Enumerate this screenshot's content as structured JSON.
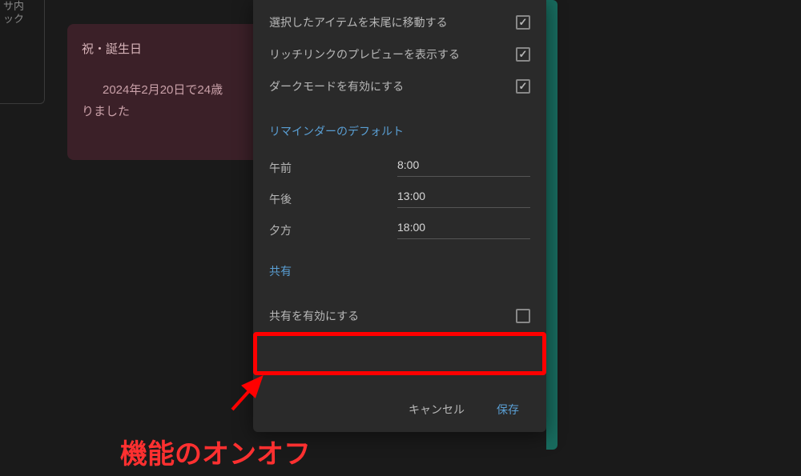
{
  "sidebar": {
    "fragment_line1": "サ内",
    "fragment_line2": "ック"
  },
  "card": {
    "title": "祝・誕生日",
    "body_line1": "2024年2月20日で24歳",
    "body_line2": "りました"
  },
  "settings": {
    "options": [
      {
        "label": "選択したアイテムを末尾に移動する",
        "checked": true
      },
      {
        "label": "リッチリンクのプレビューを表示する",
        "checked": true
      },
      {
        "label": "ダークモードを有効にする",
        "checked": true
      }
    ],
    "reminder_section_title": "リマインダーのデフォルト",
    "reminders": [
      {
        "label": "午前",
        "value": "8:00"
      },
      {
        "label": "午後",
        "value": "13:00"
      },
      {
        "label": "夕方",
        "value": "18:00"
      }
    ],
    "share_section_title": "共有",
    "share_enable_label": "共有を有効にする",
    "share_enable_checked": false,
    "cancel_label": "キャンセル",
    "save_label": "保存"
  },
  "annotation": {
    "text": "機能のオンオフ"
  }
}
